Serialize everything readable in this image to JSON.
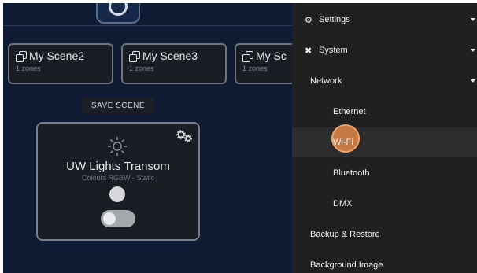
{
  "scenes": [
    {
      "name": "My Scene2",
      "zones": "1 zones"
    },
    {
      "name": "My Scene3",
      "zones": "1 zones"
    },
    {
      "name": "My Sc",
      "zones": "1 zones"
    }
  ],
  "save_scene_label": "SAVE SCENE",
  "zone": {
    "title": "UW Lights Transom",
    "subtitle": "Colours RGBW - Static"
  },
  "menu": {
    "settings": "Settings",
    "system": "System",
    "network": "Network",
    "ethernet": "Ethernet",
    "wifi": "Wi-Fi",
    "bluetooth": "Bluetooth",
    "dmx": "DMX",
    "backup": "Backup & Restore",
    "background": "Background Image"
  },
  "colors": {
    "app_bg": "#0f1b33",
    "menu_bg": "#202020",
    "touch_indicator": "#e0884a"
  }
}
